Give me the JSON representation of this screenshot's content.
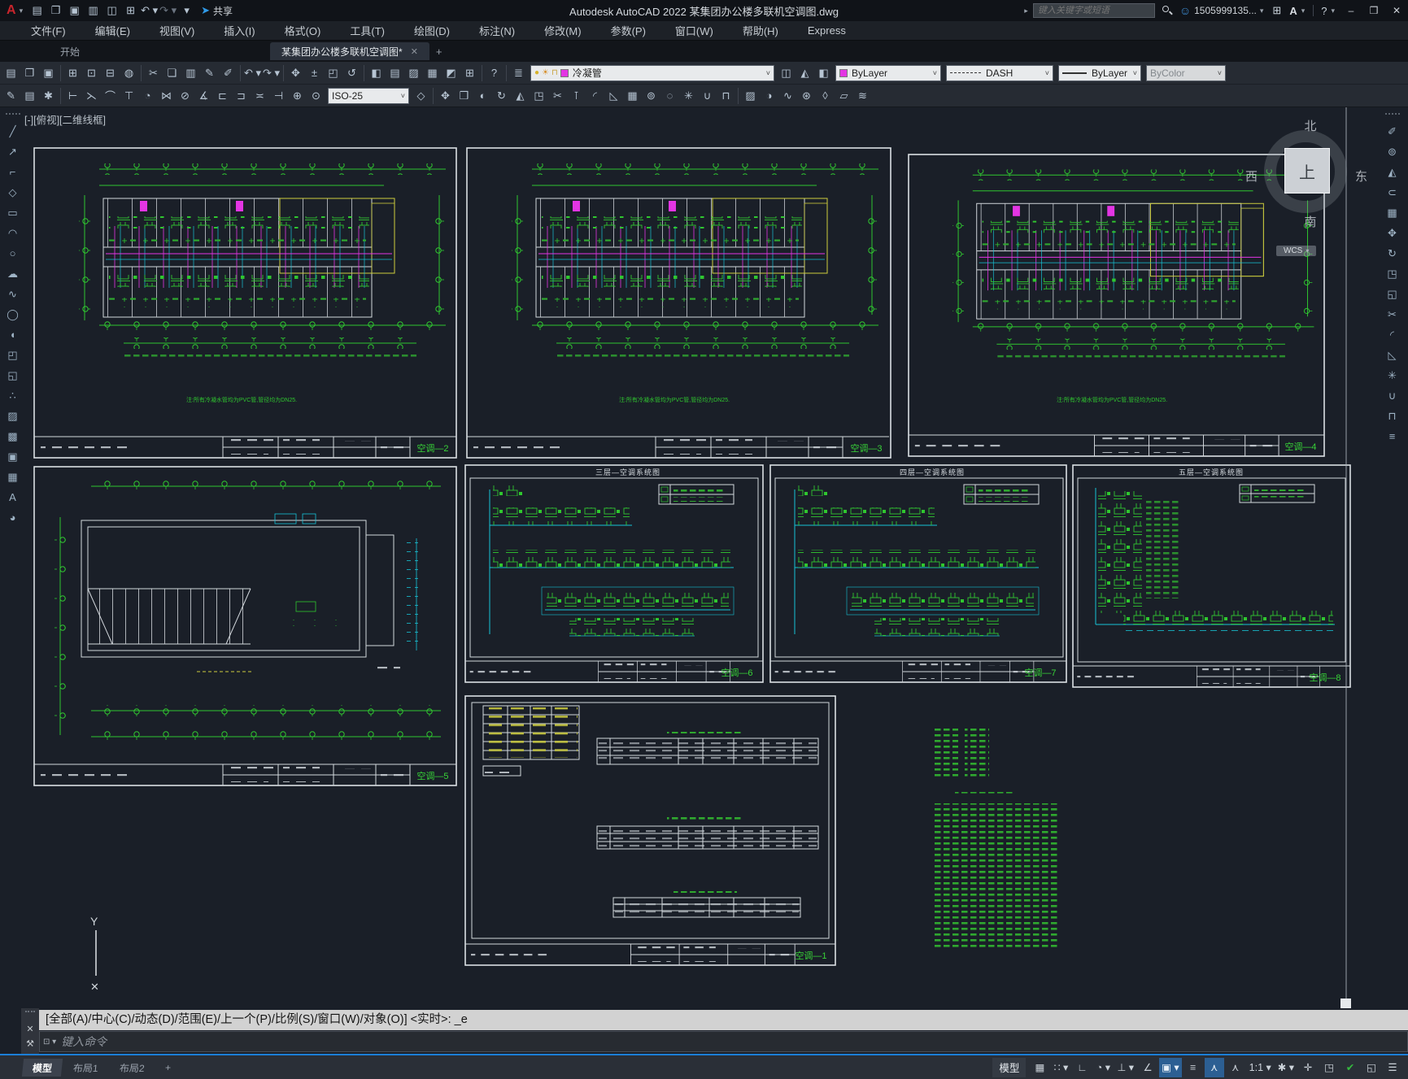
{
  "titlebar": {
    "title": "Autodesk AutoCAD 2022   某集团办公楼多联机空调图.dwg",
    "share_label": "共享",
    "search_placeholder": "键入关键字或短语",
    "account": "1505999135...",
    "help": "?",
    "window": {
      "minimize": "–",
      "maximize": "❒",
      "close": "✕"
    },
    "qa_icons": [
      {
        "n": "new-file-icon",
        "g": "▤"
      },
      {
        "n": "open-file-icon",
        "g": "❐"
      },
      {
        "n": "save-icon",
        "g": "▣"
      },
      {
        "n": "save-as-icon",
        "g": "▥"
      },
      {
        "n": "export-icon",
        "g": "◫"
      },
      {
        "n": "print-icon",
        "g": "⊞"
      },
      {
        "n": "undo-icon",
        "g": "↶ ▾"
      },
      {
        "n": "redo-icon",
        "g": "↷ ▾",
        "c": "dim"
      },
      {
        "n": "customize-quick-access-icon",
        "g": "▾"
      }
    ]
  },
  "menubar": {
    "items": [
      "文件(F)",
      "编辑(E)",
      "视图(V)",
      "插入(I)",
      "格式(O)",
      "工具(T)",
      "绘图(D)",
      "标注(N)",
      "修改(M)",
      "参数(P)",
      "窗口(W)",
      "帮助(H)",
      "Express"
    ]
  },
  "tabs": {
    "start": "开始",
    "doc": "某集团办公楼多联机空调图*",
    "close": "✕",
    "add": "+"
  },
  "toolbars": {
    "row1": [
      {
        "n": "new-icon",
        "g": "▤"
      },
      {
        "n": "open-icon",
        "g": "❐"
      },
      {
        "n": "save-icon",
        "g": "▣"
      },
      {
        "c": "sep"
      },
      {
        "n": "plot-icon",
        "g": "⊞"
      },
      {
        "n": "plot-preview-icon",
        "g": "⊡"
      },
      {
        "n": "publish-icon",
        "g": "⊟"
      },
      {
        "n": "web-icon",
        "g": "◍"
      },
      {
        "c": "sep"
      },
      {
        "n": "cut-icon",
        "g": "✂"
      },
      {
        "n": "copy-clip-icon",
        "g": "❏"
      },
      {
        "n": "paste-icon",
        "g": "▥"
      },
      {
        "n": "match-properties-icon",
        "g": "✎"
      },
      {
        "n": "block-editor-icon",
        "g": "✐"
      },
      {
        "c": "sep"
      },
      {
        "n": "undo-icon",
        "g": "↶ ▾"
      },
      {
        "n": "redo-icon",
        "g": "↷ ▾"
      },
      {
        "c": "sep"
      },
      {
        "n": "pan-icon",
        "g": "✥"
      },
      {
        "n": "zoom-realtime-icon",
        "g": "±"
      },
      {
        "n": "zoom-window-icon",
        "g": "◰"
      },
      {
        "n": "zoom-previous-icon",
        "g": "↺"
      },
      {
        "c": "sep"
      },
      {
        "n": "properties-icon",
        "g": "◧"
      },
      {
        "n": "designcenter-icon",
        "g": "▤"
      },
      {
        "n": "tool-palettes-icon",
        "g": "▨"
      },
      {
        "n": "sheet-set-manager-icon",
        "g": "▦"
      },
      {
        "n": "markup-import-icon",
        "g": "◩"
      },
      {
        "n": "quickcalc-icon",
        "g": "⊞"
      },
      {
        "c": "sep"
      },
      {
        "n": "help-icon",
        "g": "?"
      },
      {
        "c": "sep"
      },
      {
        "n": "layer-properties-icon",
        "g": "≣"
      }
    ],
    "layer_tools": [
      {
        "n": "layer-off-icon",
        "g": "◫"
      },
      {
        "n": "layer-isolate-icon",
        "g": "◭"
      },
      {
        "n": "layer-previous-icon",
        "g": "◧"
      }
    ],
    "layer_combo": {
      "value": "冷凝管"
    },
    "color_combo": {
      "value": "ByLayer"
    },
    "linetype_combo": {
      "value": "DASH"
    },
    "lineweight_combo": {
      "value": "ByLayer"
    },
    "plotstyle_combo": {
      "value": "ByColor"
    },
    "dimstyle_combo": {
      "value": "ISO-25"
    },
    "row2a": [
      {
        "n": "quick-properties-icon",
        "g": "✎"
      },
      {
        "n": "annotation-monitor-icon",
        "g": "▤"
      },
      {
        "n": "workspace-icon",
        "g": "✱"
      },
      {
        "c": "sep"
      },
      {
        "n": "dim-linear-icon",
        "g": "⊢"
      },
      {
        "n": "dim-aligned-icon",
        "g": "⋋"
      },
      {
        "n": "dim-arc-length-icon",
        "g": "⌒"
      },
      {
        "n": "dim-ordinate-icon",
        "g": "⊤"
      },
      {
        "n": "dim-radius-icon",
        "g": "◔"
      },
      {
        "n": "dim-jogged-icon",
        "g": "⋈"
      },
      {
        "n": "dim-diameter-icon",
        "g": "⊘"
      },
      {
        "n": "dim-angular-icon",
        "g": "∡"
      },
      {
        "n": "dim-baseline-icon",
        "g": "⊏"
      },
      {
        "n": "dim-continue-icon",
        "g": "⊐"
      },
      {
        "n": "dim-space-icon",
        "g": "≍"
      },
      {
        "n": "dim-break-icon",
        "g": "⊣"
      },
      {
        "n": "tolerance-icon",
        "g": "⊕"
      },
      {
        "n": "center-mark-icon",
        "g": "⊙"
      }
    ],
    "row2b": [
      {
        "n": "dim-style-icon",
        "g": "◇"
      },
      {
        "c": "sep"
      },
      {
        "n": "move-icon",
        "g": "✥"
      },
      {
        "n": "copy-icon",
        "g": "❒"
      },
      {
        "n": "stretch-icon",
        "g": "◐"
      },
      {
        "n": "rotate-icon",
        "g": "↻"
      },
      {
        "n": "mirror-icon",
        "g": "◭"
      },
      {
        "n": "scale-icon",
        "g": "◳"
      },
      {
        "n": "trim-icon",
        "g": "✂"
      },
      {
        "n": "extend-icon",
        "g": "⊺"
      },
      {
        "n": "fillet-icon",
        "g": "◜"
      },
      {
        "n": "chamfer-icon",
        "g": "◺"
      },
      {
        "n": "array-icon",
        "g": "▦"
      },
      {
        "n": "offset-icon",
        "g": "⊚"
      },
      {
        "n": "erase-icon",
        "g": "◌"
      },
      {
        "n": "explode-icon",
        "g": "✳"
      },
      {
        "n": "join-icon",
        "g": "∪"
      },
      {
        "n": "break-icon",
        "g": "⊓"
      },
      {
        "c": "sep"
      },
      {
        "n": "hatch-edit-icon",
        "g": "▨"
      },
      {
        "n": "polyline-edit-icon",
        "g": "◑"
      },
      {
        "n": "spline-edit-icon",
        "g": "∿"
      },
      {
        "n": "attribute-edit-icon",
        "g": "⊛"
      },
      {
        "n": "group-icon",
        "g": "◊"
      },
      {
        "n": "align-icon",
        "g": "▱"
      },
      {
        "n": "overlap-icon",
        "g": "≋"
      }
    ],
    "left_icons": [
      {
        "n": "line-icon",
        "g": "╱"
      },
      {
        "n": "construction-line-icon",
        "g": "↗"
      },
      {
        "n": "polyline-icon",
        "g": "⌐"
      },
      {
        "n": "polygon-icon",
        "g": "◇"
      },
      {
        "n": "rectangle-icon",
        "g": "▭"
      },
      {
        "n": "arc-icon",
        "g": "◠"
      },
      {
        "n": "circle-icon",
        "g": "○"
      },
      {
        "n": "revision-cloud-icon",
        "g": "☁"
      },
      {
        "n": "spline-icon",
        "g": "∿"
      },
      {
        "n": "ellipse-icon",
        "g": "◯"
      },
      {
        "n": "ellipse-arc-icon",
        "g": "◖"
      },
      {
        "n": "insert-block-icon",
        "g": "◰"
      },
      {
        "n": "create-block-icon",
        "g": "◱"
      },
      {
        "n": "point-icon",
        "g": "∴"
      },
      {
        "n": "hatch-icon",
        "g": "▨"
      },
      {
        "n": "gradient-icon",
        "g": "▩"
      },
      {
        "n": "region-icon",
        "g": "▣"
      },
      {
        "n": "table-icon",
        "g": "▦"
      },
      {
        "n": "mtext-icon",
        "g": "A"
      },
      {
        "n": "point-style-icon",
        "g": "◕"
      }
    ],
    "right_icons": [
      {
        "n": "erase-icon",
        "g": "✐"
      },
      {
        "n": "copy-icon",
        "g": "⊚"
      },
      {
        "n": "mirror-icon",
        "g": "◭"
      },
      {
        "n": "offset-icon",
        "g": "⊂"
      },
      {
        "n": "array-icon",
        "g": "▦"
      },
      {
        "n": "move-icon",
        "g": "✥"
      },
      {
        "n": "rotate-icon",
        "g": "↻"
      },
      {
        "n": "scale-icon",
        "g": "◳"
      },
      {
        "n": "stretch-icon",
        "g": "◱"
      },
      {
        "n": "trim-icon",
        "g": "✂"
      },
      {
        "n": "fillet-icon",
        "g": "◜"
      },
      {
        "n": "chamfer-icon",
        "g": "◺"
      },
      {
        "n": "explode-icon",
        "g": "✳"
      },
      {
        "n": "join-icon",
        "g": "∪"
      },
      {
        "n": "break-icon",
        "g": "⊓"
      },
      {
        "n": "more-tools-icon",
        "g": "≡"
      }
    ]
  },
  "canvas": {
    "viewport_controls": "[-][俯视][二维线框]",
    "viewcube": {
      "north": "北",
      "south": "南",
      "east": "东",
      "west": "西",
      "top": "上",
      "wcs": "WCS"
    },
    "ucs_y_label": "Y",
    "ucs_origin_mark": "✕",
    "drawings": {
      "plan2": {
        "label": "空调—2",
        "note": "注:所有冷凝水管均为PVC管,管径均为DN25."
      },
      "plan3": {
        "label": "空调—3",
        "note": "注:所有冷凝水管均为PVC管,管径均为DN25."
      },
      "plan4": {
        "label": "空调—4",
        "note": "注:所有冷凝水管均为PVC管,管径均为DN25."
      },
      "roof": {
        "label": "空调—5"
      },
      "sys3": {
        "title": "三层—空调系统图",
        "label": "空调—6"
      },
      "sys4": {
        "title": "四层—空调系统图",
        "label": "空调—7"
      },
      "sys5": {
        "title": "五层—空调系统图",
        "label": "空调—8"
      },
      "sheet": {
        "label": "空调—1"
      }
    }
  },
  "command": {
    "history": "[全部(A)/中心(C)/动态(D)/范围(E)/上一个(P)/比例(S)/窗口(W)/对象(O)] <实时>: _e",
    "placeholder": "键入命令",
    "close": "✕",
    "wrench": "⚒"
  },
  "statusbar": {
    "model_tabs": [
      {
        "n": "model-tab",
        "t": "模型",
        "c": "active"
      },
      {
        "n": "layout1-tab",
        "t": "布局1"
      },
      {
        "n": "layout2-tab",
        "t": "布局2"
      },
      {
        "n": "new-layout-tab",
        "t": "+"
      }
    ],
    "icons": [
      {
        "n": "model-paper-toggle",
        "t": "模型",
        "c": "btn"
      },
      {
        "n": "grid-icon",
        "g": "▦"
      },
      {
        "n": "snap-mode-icon",
        "g": "∷ ▾"
      },
      {
        "n": "ortho-icon",
        "g": "∟"
      },
      {
        "n": "polar-tracking-icon",
        "g": "◔ ▾"
      },
      {
        "n": "isodraft-icon",
        "g": "⊥ ▾"
      },
      {
        "n": "otrack-icon",
        "g": "∠"
      },
      {
        "n": "osnap-icon",
        "g": "▣ ▾",
        "c": "hl"
      },
      {
        "n": "lineweight-display-icon",
        "g": "≡"
      },
      {
        "n": "annotation-visibility-icon",
        "g": "⋏",
        "c": "hl"
      },
      {
        "n": "autoscale-icon",
        "g": "⋏"
      },
      {
        "n": "annotation-scale-icon",
        "t": "1:1 ▾"
      },
      {
        "n": "workspace-switching-icon",
        "g": "✱ ▾"
      },
      {
        "n": "crosshair-icon",
        "g": "✛"
      },
      {
        "n": "isolate-objects-icon",
        "g": "◳"
      },
      {
        "n": "graphics-performance-icon",
        "g": "✔",
        "c": "hl2"
      },
      {
        "n": "clean-screen-icon",
        "g": "◱"
      },
      {
        "n": "customization-menu-icon",
        "g": "☰"
      }
    ]
  }
}
